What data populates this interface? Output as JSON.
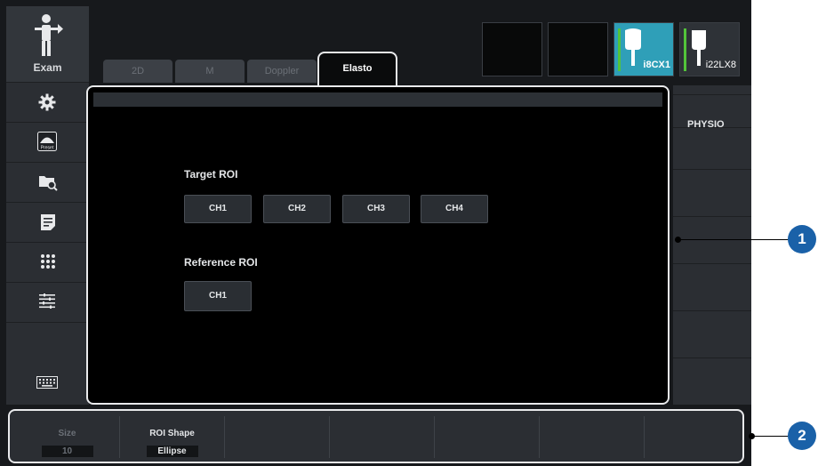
{
  "sidebar": {
    "exam_label": "Exam",
    "items": [
      {
        "icon": "gear-icon"
      },
      {
        "icon": "preset-icon",
        "label": "Preset"
      },
      {
        "icon": "folder-search-icon"
      },
      {
        "icon": "report-icon"
      },
      {
        "icon": "grid-icon"
      },
      {
        "icon": "list-icon"
      },
      {
        "icon": "keyboard-icon"
      }
    ]
  },
  "tabs": {
    "t2d": "2D",
    "tm": "M",
    "tdoppler": "Doppler",
    "telasto": "Elasto",
    "active": "Elasto"
  },
  "probes": {
    "probe1": "i8CX1",
    "probe2": "i22LX8",
    "active": "i8CX1"
  },
  "right_panel": {
    "physio": "PHYSIO"
  },
  "main": {
    "target_roi": {
      "label": "Target ROI",
      "buttons": [
        "CH1",
        "CH2",
        "CH3",
        "CH4"
      ]
    },
    "reference_roi": {
      "label": "Reference ROI",
      "buttons": [
        "CH1"
      ]
    }
  },
  "bottom_bar": {
    "size": {
      "label": "Size",
      "value": "10"
    },
    "roi_shape": {
      "label": "ROI Shape",
      "value": "Ellipse"
    }
  },
  "callouts": [
    "1",
    "2"
  ],
  "colors": {
    "active_probe": "#2f9fb8",
    "callout": "#1a61a8",
    "probe_indicator": "#53c43a"
  }
}
